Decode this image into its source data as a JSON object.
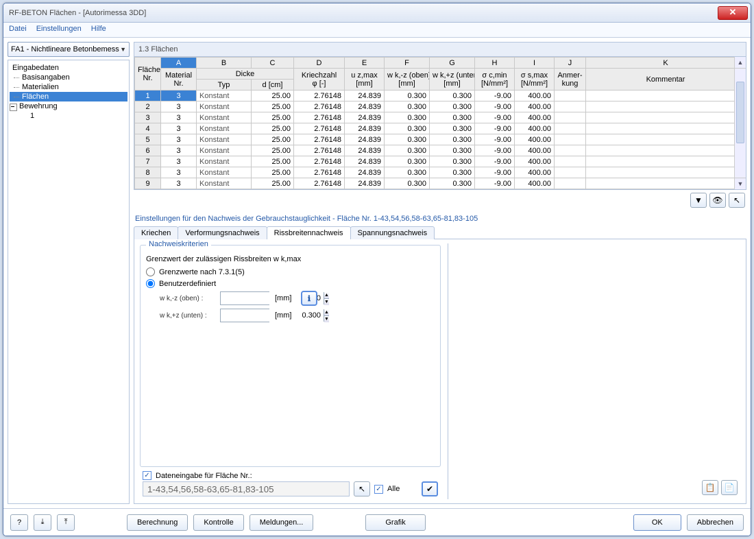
{
  "window": {
    "title": "RF-BETON Flächen - [Autorimessa 3DD]"
  },
  "menu": {
    "file": "Datei",
    "settings": "Einstellungen",
    "help": "Hilfe"
  },
  "combo": {
    "value": "FA1 - Nichtlineare Betonbemess"
  },
  "tree": {
    "root": "Eingabedaten",
    "n1": "Basisangaben",
    "n2": "Materialien",
    "n3": "Flächen",
    "n4": "Bewehrung",
    "n4a": "1"
  },
  "section": {
    "title": "1.3 Flächen"
  },
  "grid": {
    "letters": [
      "A",
      "B",
      "C",
      "D",
      "E",
      "F",
      "G",
      "H",
      "I",
      "J",
      "K"
    ],
    "group_dicke": "Dicke",
    "h_flaeche1": "Fläche",
    "h_flaeche2": "Nr.",
    "h_mat1": "Material",
    "h_mat2": "Nr.",
    "h_typ": "Typ",
    "h_d": "d [cm]",
    "h_kriech1": "Kriechzahl",
    "h_kriech2": "φ [-]",
    "h_uz1": "u z,max",
    "h_mm": "[mm]",
    "h_wkz": "w k,-z (oben)",
    "h_wkz2": "w k,+z (unten)",
    "h_sc": "σ c,min",
    "h_ss": "σ s,max",
    "h_nmm": "[N/mm²]",
    "h_anm1": "Anmer-",
    "h_anm2": "kung",
    "h_komm": "Kommentar",
    "rows": [
      {
        "n": "1",
        "mat": "3",
        "typ": "Konstant",
        "d": "25.00",
        "phi": "2.76148",
        "uz": "24.839",
        "wkz": "0.300",
        "wkz2": "0.300",
        "sc": "-9.00",
        "ss": "400.00"
      },
      {
        "n": "2",
        "mat": "3",
        "typ": "Konstant",
        "d": "25.00",
        "phi": "2.76148",
        "uz": "24.839",
        "wkz": "0.300",
        "wkz2": "0.300",
        "sc": "-9.00",
        "ss": "400.00"
      },
      {
        "n": "3",
        "mat": "3",
        "typ": "Konstant",
        "d": "25.00",
        "phi": "2.76148",
        "uz": "24.839",
        "wkz": "0.300",
        "wkz2": "0.300",
        "sc": "-9.00",
        "ss": "400.00"
      },
      {
        "n": "4",
        "mat": "3",
        "typ": "Konstant",
        "d": "25.00",
        "phi": "2.76148",
        "uz": "24.839",
        "wkz": "0.300",
        "wkz2": "0.300",
        "sc": "-9.00",
        "ss": "400.00"
      },
      {
        "n": "5",
        "mat": "3",
        "typ": "Konstant",
        "d": "25.00",
        "phi": "2.76148",
        "uz": "24.839",
        "wkz": "0.300",
        "wkz2": "0.300",
        "sc": "-9.00",
        "ss": "400.00"
      },
      {
        "n": "6",
        "mat": "3",
        "typ": "Konstant",
        "d": "25.00",
        "phi": "2.76148",
        "uz": "24.839",
        "wkz": "0.300",
        "wkz2": "0.300",
        "sc": "-9.00",
        "ss": "400.00"
      },
      {
        "n": "7",
        "mat": "3",
        "typ": "Konstant",
        "d": "25.00",
        "phi": "2.76148",
        "uz": "24.839",
        "wkz": "0.300",
        "wkz2": "0.300",
        "sc": "-9.00",
        "ss": "400.00"
      },
      {
        "n": "8",
        "mat": "3",
        "typ": "Konstant",
        "d": "25.00",
        "phi": "2.76148",
        "uz": "24.839",
        "wkz": "0.300",
        "wkz2": "0.300",
        "sc": "-9.00",
        "ss": "400.00"
      },
      {
        "n": "9",
        "mat": "3",
        "typ": "Konstant",
        "d": "25.00",
        "phi": "2.76148",
        "uz": "24.839",
        "wkz": "0.300",
        "wkz2": "0.300",
        "sc": "-9.00",
        "ss": "400.00"
      }
    ]
  },
  "subtitle": "Einstellungen für den Nachweis der Gebrauchstauglichkeit - Fläche Nr. 1-43,54,56,58-63,65-81,83-105",
  "tabs": {
    "t1": "Kriechen",
    "t2": "Verformungsnachweis",
    "t3": "Rissbreitennachweis",
    "t4": "Spannungsnachweis"
  },
  "panel": {
    "group_title": "Nachweiskriterien",
    "caption": "Grenzwert der zulässigen Rissbreiten w k,max",
    "opt1": "Grenzwerte nach 7.3.1(5)",
    "opt2": "Benutzerdefiniert",
    "f1_label": "w k,-z (oben) :",
    "f1_value": "0.300",
    "unit": "[mm]",
    "f2_label": "w k,+z (unten) :",
    "f2_value": "0.300",
    "chk_label": "Dateneingabe für Fläche Nr.:",
    "range": "1-43,54,56,58-63,65-81,83-105",
    "alle": "Alle"
  },
  "footer": {
    "calc": "Berechnung",
    "check": "Kontrolle",
    "msgs": "Meldungen...",
    "graphic": "Grafik",
    "ok": "OK",
    "cancel": "Abbrechen"
  }
}
